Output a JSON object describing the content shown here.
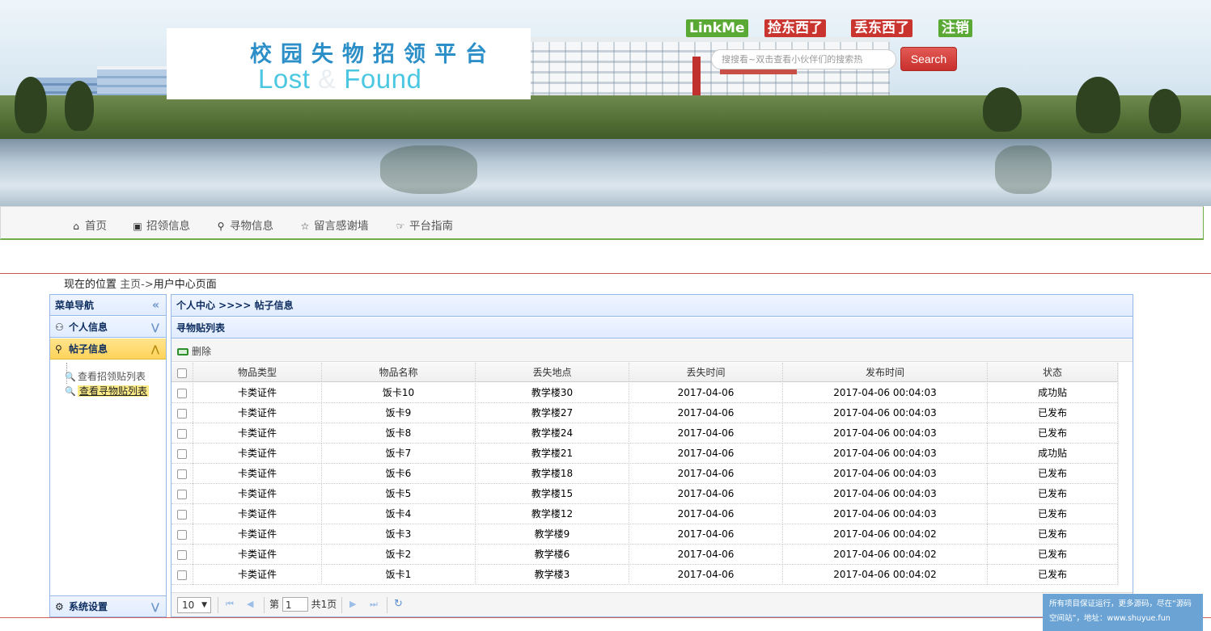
{
  "header": {
    "logo_cn": "校园失物招领平台",
    "logo_en_1": "Lost",
    "logo_en_amp": "&",
    "logo_en_2": "Found",
    "links": [
      {
        "label": "LinkMe",
        "style": "green"
      },
      {
        "label": "捡东西了",
        "style": "red"
      },
      {
        "label": "丢东西了",
        "style": "red"
      },
      {
        "label": "注销",
        "style": "green"
      }
    ],
    "search_placeholder": "搜搜看~双击查看小伙伴们的搜索热",
    "search_button": "Search"
  },
  "nav": {
    "items": [
      {
        "label": "首页",
        "icon": "home-icon"
      },
      {
        "label": "招领信息",
        "icon": "picture-icon"
      },
      {
        "label": "寻物信息",
        "icon": "zoom-icon"
      },
      {
        "label": "留言感谢墙",
        "icon": "star-icon"
      },
      {
        "label": "平台指南",
        "icon": "hand-right-icon"
      }
    ]
  },
  "breadcrumb": {
    "prefix": "现在的位置",
    "path_home": "主页->",
    "path_current": "用户中心页面"
  },
  "sidebar": {
    "title": "菜单导航",
    "sections": [
      {
        "label": "个人信息",
        "icon": "user-icon"
      },
      {
        "label": "帖子信息",
        "icon": "zoom-icon"
      },
      {
        "label": "系统设置",
        "icon": "gear-icon"
      }
    ],
    "tree": [
      {
        "label": "查看招领贴列表",
        "selected": false
      },
      {
        "label": "查看寻物贴列表",
        "selected": true
      }
    ]
  },
  "panel": {
    "title": "个人中心 >>>> 帖子信息",
    "subtitle": "寻物贴列表",
    "delete_label": "删除",
    "columns": [
      "物品类型",
      "物品名称",
      "丢失地点",
      "丢失时间",
      "发布时间",
      "状态"
    ],
    "rows": [
      [
        "卡类证件",
        "饭卡10",
        "教学楼30",
        "2017-04-06",
        "2017-04-06 00:04:03",
        "成功贴"
      ],
      [
        "卡类证件",
        "饭卡9",
        "教学楼27",
        "2017-04-06",
        "2017-04-06 00:04:03",
        "已发布"
      ],
      [
        "卡类证件",
        "饭卡8",
        "教学楼24",
        "2017-04-06",
        "2017-04-06 00:04:03",
        "已发布"
      ],
      [
        "卡类证件",
        "饭卡7",
        "教学楼21",
        "2017-04-06",
        "2017-04-06 00:04:03",
        "成功贴"
      ],
      [
        "卡类证件",
        "饭卡6",
        "教学楼18",
        "2017-04-06",
        "2017-04-06 00:04:03",
        "已发布"
      ],
      [
        "卡类证件",
        "饭卡5",
        "教学楼15",
        "2017-04-06",
        "2017-04-06 00:04:03",
        "已发布"
      ],
      [
        "卡类证件",
        "饭卡4",
        "教学楼12",
        "2017-04-06",
        "2017-04-06 00:04:03",
        "已发布"
      ],
      [
        "卡类证件",
        "饭卡3",
        "教学楼9",
        "2017-04-06",
        "2017-04-06 00:04:02",
        "已发布"
      ],
      [
        "卡类证件",
        "饭卡2",
        "教学楼6",
        "2017-04-06",
        "2017-04-06 00:04:02",
        "已发布"
      ],
      [
        "卡类证件",
        "饭卡1",
        "教学楼3",
        "2017-04-06",
        "2017-04-06 00:04:02",
        "已发布"
      ]
    ],
    "pager": {
      "page_size": "10",
      "page_prefix": "第",
      "page_value": "1",
      "page_total": "共1页"
    }
  },
  "promo": {
    "line1": "所有项目保证运行，更多源码，尽在“源码",
    "line2": "空间站”，地址：www.shuyue.fun"
  },
  "colors": {
    "accent_green": "#5aa935",
    "accent_red": "#c9342f",
    "panel_border": "#95b8e7",
    "active_section": "#ffd35a"
  }
}
